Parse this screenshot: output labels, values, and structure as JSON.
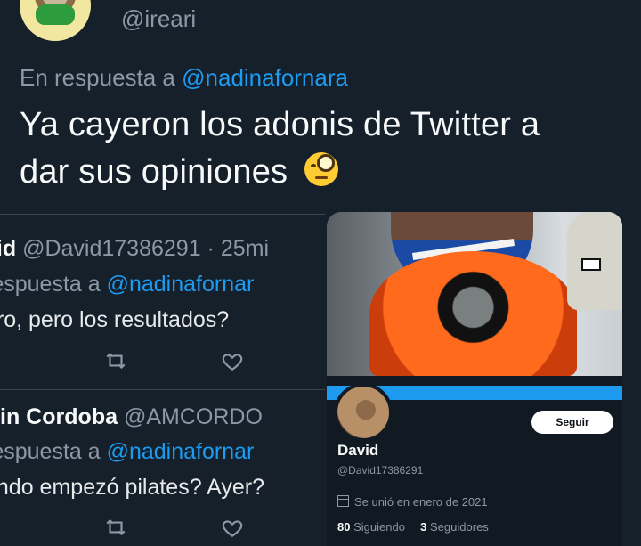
{
  "main_tweet": {
    "handle": "@ireari",
    "reply_prefix": "En respuesta a",
    "reply_to": "@nadinafornara",
    "text": "Ya cayeron los adonis de Twitter a dar sus opiniones",
    "emoji": "face-with-monocle"
  },
  "replies": [
    {
      "name": "vid",
      "handle_time": "@David17386291 · 25mi",
      "reply_prefix": "respuesta a",
      "reply_to": "@nadinafornar",
      "text": "aro, pero los resultados?",
      "icons": [
        "retweet-icon",
        "like-icon"
      ]
    },
    {
      "name": "rtin Cordoba",
      "handle": "@AMCORDO",
      "reply_prefix": "respuesta a",
      "reply_to": "@nadinafornar",
      "text": "ando empezó pilates? Ayer?",
      "icons": [
        "retweet-icon",
        "like-icon"
      ]
    }
  ],
  "profile_card": {
    "follow_label": "Seguir",
    "name": "David",
    "handle": "@David17386291",
    "joined": "Se unió en enero de 2021",
    "following_count": "80",
    "following_label": "Siguiendo",
    "followers_count": "3",
    "followers_label": "Seguidores"
  },
  "colors": {
    "background": "#15202b",
    "accent": "#1d9bf0",
    "muted": "#8b98a5"
  }
}
